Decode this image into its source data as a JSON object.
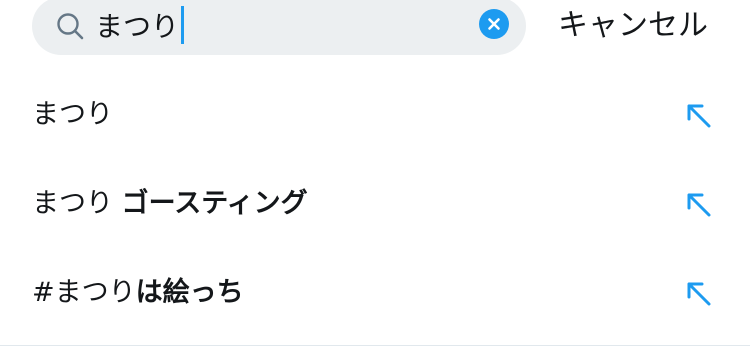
{
  "search": {
    "query": "まつり",
    "clear_icon": "close-icon",
    "search_icon": "search-icon"
  },
  "cancel_label": "キャンセル",
  "suggestions": [
    {
      "prefix": "まつり",
      "suffix": "",
      "icon": "arrow-up-left-icon"
    },
    {
      "prefix": "まつり ",
      "suffix": "ゴースティング",
      "icon": "arrow-up-left-icon"
    },
    {
      "prefix": "#まつり",
      "suffix": "は絵っち",
      "icon": "arrow-up-left-icon"
    }
  ],
  "colors": {
    "accent": "#1d9bf0",
    "search_bg": "#eceff1",
    "text": "#14171a"
  }
}
